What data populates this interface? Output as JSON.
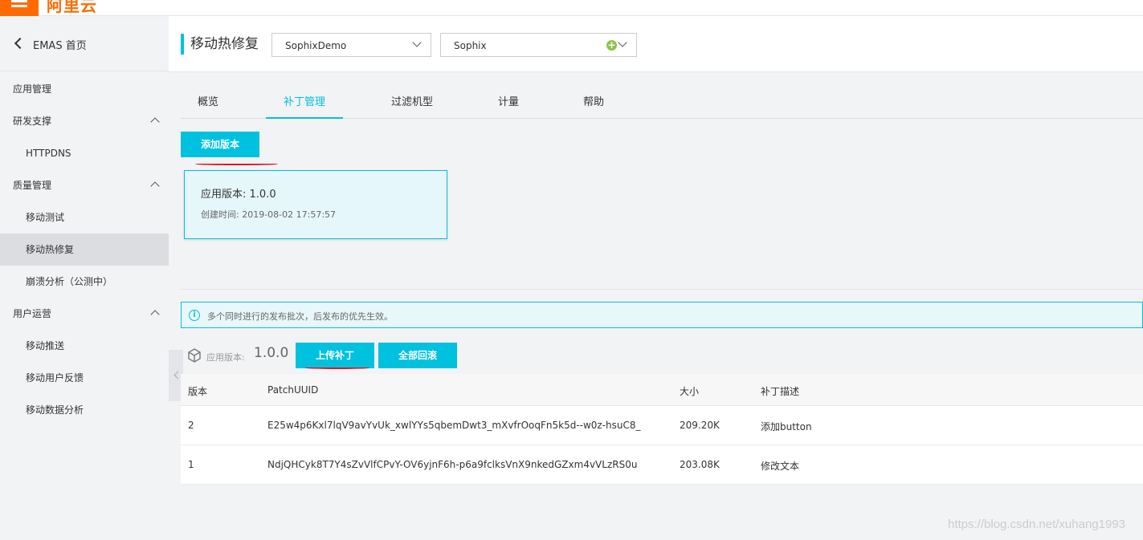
{
  "brand": {
    "logo_text": "阿里云",
    "accent": "#ff6a00",
    "primary": "#00c1de"
  },
  "sidebar": {
    "back_label": "EMAS 首页",
    "items": [
      {
        "label": "应用管理",
        "type": "group"
      },
      {
        "label": "研发支撑",
        "type": "group",
        "expanded": true
      },
      {
        "label": "HTTPDNS",
        "type": "sub"
      },
      {
        "label": "质量管理",
        "type": "group",
        "expanded": true
      },
      {
        "label": "移动测试",
        "type": "sub"
      },
      {
        "label": "移动热修复",
        "type": "sub",
        "active": true
      },
      {
        "label": "崩溃分析（公测中）",
        "type": "sub"
      },
      {
        "label": "用户运营",
        "type": "group",
        "expanded": true
      },
      {
        "label": "移动推送",
        "type": "sub"
      },
      {
        "label": "移动用户反馈",
        "type": "sub"
      },
      {
        "label": "移动数据分析",
        "type": "sub"
      }
    ]
  },
  "header": {
    "title": "移动热修复",
    "app_select": "SophixDemo",
    "product_select": "Sophix"
  },
  "tabs": [
    {
      "label": "概览"
    },
    {
      "label": "补丁管理",
      "active": true
    },
    {
      "label": "过滤机型"
    },
    {
      "label": "计量"
    },
    {
      "label": "帮助"
    }
  ],
  "main": {
    "add_version_label": "添加版本",
    "version_card": {
      "version": "应用版本: 1.0.0",
      "created": "创建时间: 2019-08-02 17:57:57"
    },
    "notice": "多个同时进行的发布批次，后发布的优先生效。",
    "version_label": "应用版本:",
    "version_value": "1.0.0",
    "upload_patch_label": "上传补丁",
    "rollback_all_label": "全部回滚"
  },
  "table": {
    "columns": [
      "版本",
      "PatchUUID",
      "大小",
      "补丁描述"
    ],
    "rows": [
      [
        "2",
        "E25w4p6Kxl7lqV9avYvUk_xwlYYs5qbemDwt3_mXvfrOoqFn5k5d--w0z-hsuC8_",
        "209.20K",
        "添加button"
      ],
      [
        "1",
        "NdjQHCyk8T7Y4sZvVlfCPvY-OV6yjnF6h-p6a9fclksVnX9nkedGZxm4vVLzRS0u",
        "203.08K",
        "修改文本"
      ]
    ]
  },
  "watermark": "https://blog.csdn.net/xuhang1993"
}
